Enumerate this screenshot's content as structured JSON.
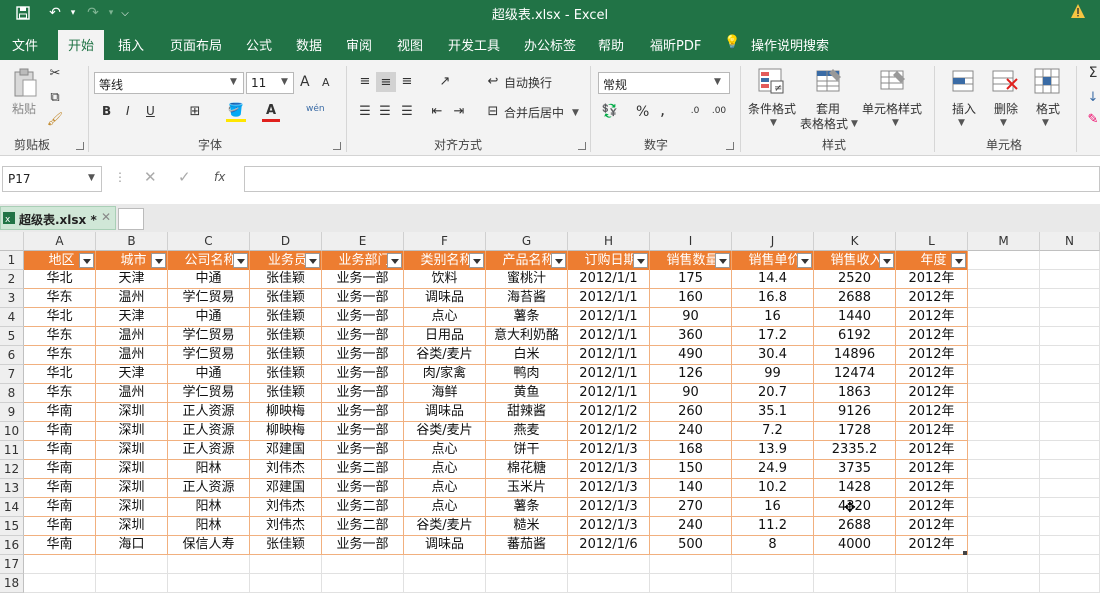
{
  "title_bar": {
    "title": "超级表.xlsx  -  Excel"
  },
  "menu": {
    "tabs": [
      "文件",
      "开始",
      "插入",
      "页面布局",
      "公式",
      "数据",
      "审阅",
      "视图",
      "开发工具",
      "办公标签",
      "帮助",
      "福昕PDF",
      "操作说明搜索"
    ],
    "active": "开始"
  },
  "ribbon": {
    "clipboard": {
      "paste": "粘贴",
      "label": "剪贴板"
    },
    "font": {
      "name": "等线",
      "size": "11",
      "bold": "B",
      "italic": "I",
      "underline": "U",
      "grow": "A",
      "shrink": "A",
      "label": "字体",
      "pinyin": "wén"
    },
    "alignment": {
      "wrap": "自动换行",
      "merge": "合并后居中",
      "label": "对齐方式"
    },
    "number": {
      "format": "常规",
      "percent": "%",
      "comma": ",",
      "label": "数字",
      "inc_dec": "←0\n.00",
      "dec_dec": ".00\n→0"
    },
    "styles": {
      "cond": "条件格式",
      "table": "套用\n表格格式",
      "cell": "单元格样式",
      "label": "样式"
    },
    "cells": {
      "insert": "插入",
      "delete": "删除",
      "format": "格式",
      "label": "单元格"
    }
  },
  "formula_bar": {
    "name_box": "P17",
    "fx": "fx"
  },
  "workbook_tab": {
    "name": "超级表.xlsx *"
  },
  "columns": [
    "A",
    "B",
    "C",
    "D",
    "E",
    "F",
    "G",
    "H",
    "I",
    "J",
    "K",
    "L",
    "M",
    "N"
  ],
  "table": {
    "headers": [
      "地区",
      "城市",
      "公司名称",
      "业务员",
      "业务部门",
      "类别名称",
      "产品名称",
      "订购日期",
      "销售数量",
      "销售单价",
      "销售收入",
      "年度"
    ],
    "rows": [
      [
        "华北",
        "天津",
        "中通",
        "张佳颖",
        "业务一部",
        "饮料",
        "蜜桃汁",
        "2012/1/1",
        "175",
        "14.4",
        "2520",
        "2012年"
      ],
      [
        "华东",
        "温州",
        "学仁贸易",
        "张佳颖",
        "业务一部",
        "调味品",
        "海苔酱",
        "2012/1/1",
        "160",
        "16.8",
        "2688",
        "2012年"
      ],
      [
        "华北",
        "天津",
        "中通",
        "张佳颖",
        "业务一部",
        "点心",
        "薯条",
        "2012/1/1",
        "90",
        "16",
        "1440",
        "2012年"
      ],
      [
        "华东",
        "温州",
        "学仁贸易",
        "张佳颖",
        "业务一部",
        "日用品",
        "意大利奶酪",
        "2012/1/1",
        "360",
        "17.2",
        "6192",
        "2012年"
      ],
      [
        "华东",
        "温州",
        "学仁贸易",
        "张佳颖",
        "业务一部",
        "谷类/麦片",
        "白米",
        "2012/1/1",
        "490",
        "30.4",
        "14896",
        "2012年"
      ],
      [
        "华北",
        "天津",
        "中通",
        "张佳颖",
        "业务一部",
        "肉/家禽",
        "鸭肉",
        "2012/1/1",
        "126",
        "99",
        "12474",
        "2012年"
      ],
      [
        "华东",
        "温州",
        "学仁贸易",
        "张佳颖",
        "业务一部",
        "海鲜",
        "黄鱼",
        "2012/1/1",
        "90",
        "20.7",
        "1863",
        "2012年"
      ],
      [
        "华南",
        "深圳",
        "正人资源",
        "柳映梅",
        "业务一部",
        "调味品",
        "甜辣酱",
        "2012/1/2",
        "260",
        "35.1",
        "9126",
        "2012年"
      ],
      [
        "华南",
        "深圳",
        "正人资源",
        "柳映梅",
        "业务一部",
        "谷类/麦片",
        "燕麦",
        "2012/1/2",
        "240",
        "7.2",
        "1728",
        "2012年"
      ],
      [
        "华南",
        "深圳",
        "正人资源",
        "邓建国",
        "业务一部",
        "点心",
        "饼干",
        "2012/1/3",
        "168",
        "13.9",
        "2335.2",
        "2012年"
      ],
      [
        "华南",
        "深圳",
        "阳林",
        "刘伟杰",
        "业务二部",
        "点心",
        "棉花糖",
        "2012/1/3",
        "150",
        "24.9",
        "3735",
        "2012年"
      ],
      [
        "华南",
        "深圳",
        "正人资源",
        "邓建国",
        "业务一部",
        "点心",
        "玉米片",
        "2012/1/3",
        "140",
        "10.2",
        "1428",
        "2012年"
      ],
      [
        "华南",
        "深圳",
        "阳林",
        "刘伟杰",
        "业务二部",
        "点心",
        "薯条",
        "2012/1/3",
        "270",
        "16",
        "4320",
        "2012年"
      ],
      [
        "华南",
        "深圳",
        "阳林",
        "刘伟杰",
        "业务二部",
        "谷类/麦片",
        "糙米",
        "2012/1/3",
        "240",
        "11.2",
        "2688",
        "2012年"
      ],
      [
        "华南",
        "海口",
        "保信人寿",
        "张佳颖",
        "业务一部",
        "调味品",
        "蕃茄酱",
        "2012/1/6",
        "500",
        "8",
        "4000",
        "2012年"
      ]
    ]
  },
  "row_numbers": [
    "1",
    "2",
    "3",
    "4",
    "5",
    "6",
    "7",
    "8",
    "9",
    "10",
    "11",
    "12",
    "13",
    "14",
    "15",
    "16",
    "17",
    "18"
  ],
  "colors": {
    "excel_green": "#217346",
    "table_header": "#ed7d31",
    "table_border": "#f1b07f"
  }
}
